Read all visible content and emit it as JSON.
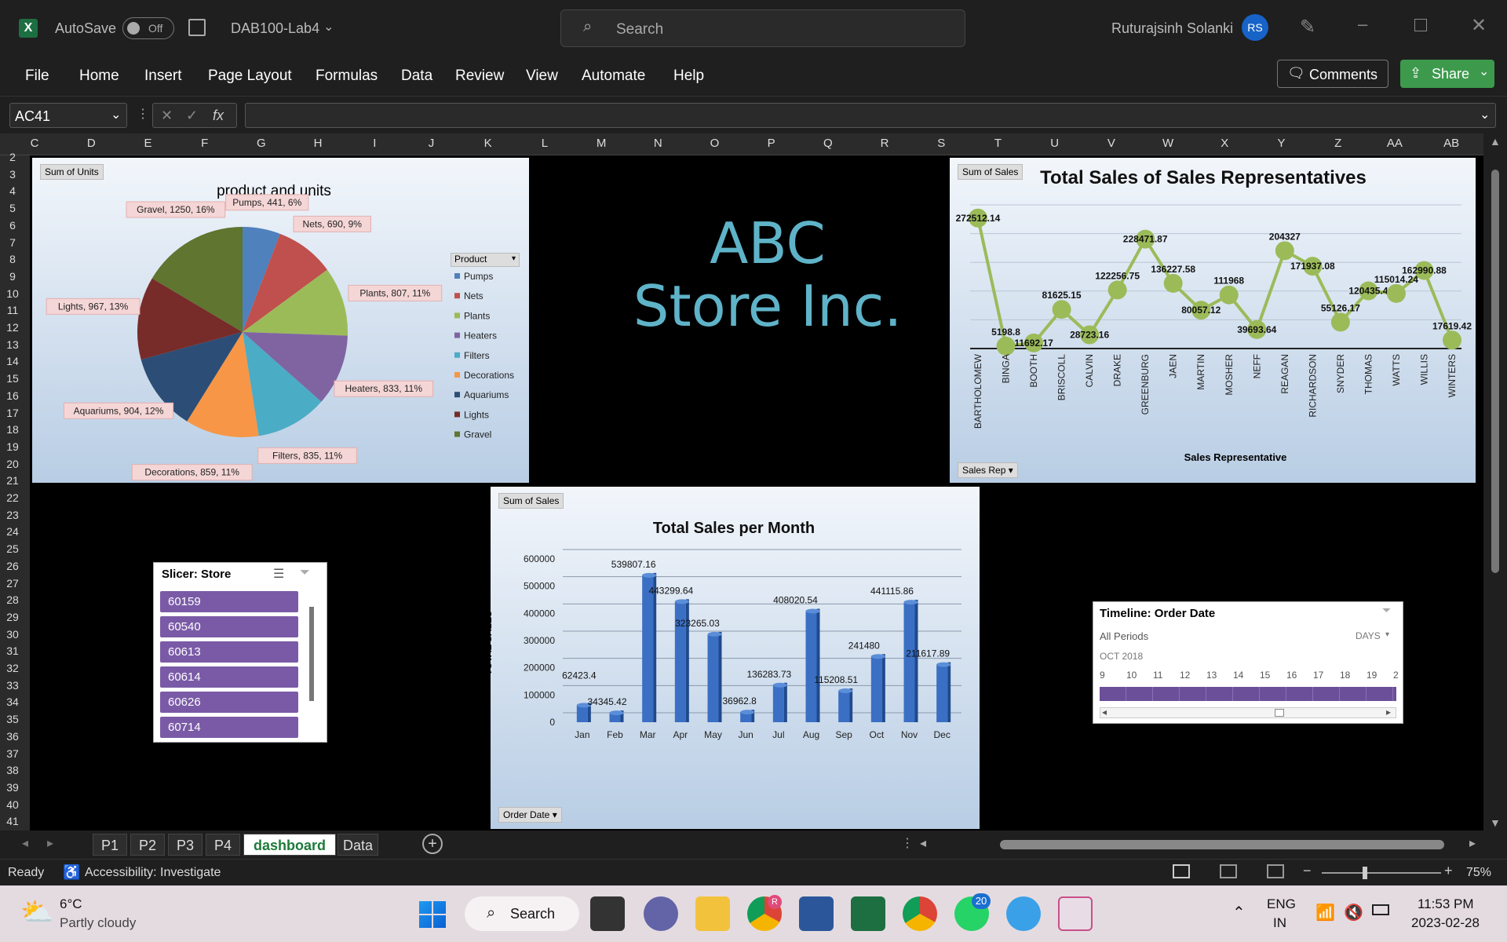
{
  "titlebar": {
    "autosave_label": "AutoSave",
    "autosave_state": "Off",
    "filename": "DAB100-Lab4",
    "search_placeholder": "Search",
    "user_name": "Ruturajsinh Solanki",
    "user_initials": "RS"
  },
  "ribbon": {
    "tabs": [
      "File",
      "Home",
      "Insert",
      "Page Layout",
      "Formulas",
      "Data",
      "Review",
      "View",
      "Automate",
      "Help"
    ],
    "comments_label": "Comments",
    "share_label": "Share"
  },
  "formula_bar": {
    "name_box": "AC41",
    "fx": "fx",
    "value": ""
  },
  "columns": [
    "C",
    "D",
    "E",
    "F",
    "G",
    "H",
    "I",
    "J",
    "K",
    "L",
    "M",
    "N",
    "O",
    "P",
    "Q",
    "R",
    "S",
    "T",
    "U",
    "V",
    "W",
    "X",
    "Y",
    "Z",
    "AA",
    "AB"
  ],
  "rows": [
    "2",
    "3",
    "4",
    "5",
    "6",
    "7",
    "8",
    "9",
    "10",
    "11",
    "12",
    "13",
    "14",
    "15",
    "16",
    "17",
    "18",
    "19",
    "20",
    "21",
    "22",
    "23",
    "24",
    "25",
    "26",
    "27",
    "28",
    "29",
    "30",
    "31",
    "32",
    "33",
    "34",
    "35",
    "36",
    "37",
    "38",
    "39",
    "40",
    "41"
  ],
  "banner": {
    "line1": "ABC",
    "line2": "Store Inc.",
    "color": "#5fb3c8"
  },
  "pie_chart": {
    "field_button": "Sum of Units",
    "title": "product and units",
    "legend_title": "Product",
    "chart_data": {
      "type": "pie",
      "title": "product and units",
      "series": [
        {
          "name": "Sum of Units",
          "values": [
            441,
            690,
            807,
            833,
            835,
            859,
            904,
            967,
            1250
          ]
        }
      ],
      "categories": [
        "Pumps",
        "Nets",
        "Plants",
        "Heaters",
        "Filters",
        "Decorations",
        "Aquariums",
        "Lights",
        "Gravel"
      ],
      "labels": [
        "Pumps, 441, 6%",
        "Nets, 690, 9%",
        "Plants, 807, 11%",
        "Heaters, 833, 11%",
        "Filters, 835, 11%",
        "Decorations, 859, 11%",
        "Aquariums, 904, 12%",
        "Lights, 967, 13%",
        "Gravel, 1250, 16%"
      ],
      "colors": [
        "#4f81bd",
        "#c0504d",
        "#9bbb59",
        "#8064a2",
        "#4bacc6",
        "#f79646",
        "#2c4d75",
        "#772c2a",
        "#5f7530"
      ],
      "legend": "right"
    }
  },
  "line_chart": {
    "field_button": "Sum of Sales",
    "axis_button": "Sales Rep",
    "chart_data": {
      "type": "line",
      "title": "Total Sales of Sales Representatives",
      "xlabel": "Sales Representative",
      "ylabel": "",
      "categories": [
        "BARTHOLOMEW",
        "BINGA",
        "BOOTH",
        "BRISCOLL",
        "CALVIN",
        "DRAKE",
        "GREENBURG",
        "JAEN",
        "MARTIN",
        "MOSHER",
        "NEFF",
        "REAGAN",
        "RICHARDSON",
        "SNYDER",
        "THOMAS",
        "WATTS",
        "WILLIS",
        "WINTERS"
      ],
      "series": [
        {
          "values": [
            272512.14,
            5198.8,
            11692.17,
            81625.15,
            28723.16,
            122256.75,
            228471.87,
            136227.58,
            80057.12,
            111968,
            39693.64,
            204327,
            171937.08,
            55126.17,
            120435.4,
            115014.24,
            162990.88,
            17619.42
          ]
        }
      ],
      "ylim": [
        0,
        300000
      ],
      "color": "#9bbb59"
    }
  },
  "bar_chart": {
    "field_button": "Sum of Sales",
    "axis_button": "Order Date",
    "chart_data": {
      "type": "bar",
      "title": "Total Sales per Month",
      "xlabel": "",
      "ylabel": "TOTAL SALES",
      "categories": [
        "Jan",
        "Feb",
        "Mar",
        "Apr",
        "May",
        "Jun",
        "Jul",
        "Aug",
        "Sep",
        "Oct",
        "Nov",
        "Dec"
      ],
      "values": [
        62423.4,
        34345.42,
        539807.16,
        443299.64,
        323265.03,
        36962.8,
        136283.73,
        408020.54,
        115208.51,
        241480,
        441115.86,
        211617.89
      ],
      "yticks": [
        "0",
        "100000",
        "200000",
        "300000",
        "400000",
        "500000",
        "600000"
      ],
      "ylim": [
        0,
        600000
      ],
      "color": "#3a6fc4"
    }
  },
  "slicer": {
    "title": "Slicer: Store",
    "items": [
      "60159",
      "60540",
      "60613",
      "60614",
      "60626",
      "60714"
    ]
  },
  "timeline": {
    "title": "Timeline: Order Date",
    "periods": "All Periods",
    "unit": "DAYS",
    "month": "OCT 2018",
    "days": [
      "9",
      "10",
      "11",
      "12",
      "13",
      "14",
      "15",
      "16",
      "17",
      "18",
      "19",
      "2"
    ]
  },
  "sheet_tabs": {
    "tabs": [
      "P1",
      "P2",
      "P3",
      "P4",
      "dashboard",
      "Data"
    ],
    "active": "dashboard"
  },
  "status": {
    "ready": "Ready",
    "accessibility": "Accessibility: Investigate",
    "zoom": "75%"
  },
  "taskbar": {
    "temp": "6°C",
    "weather": "Partly cloudy",
    "search": "Search",
    "lang1": "ENG",
    "lang2": "IN",
    "time": "11:53 PM",
    "date": "2023-02-28",
    "badge_whatsapp": "20",
    "badge_chrome": "R"
  }
}
